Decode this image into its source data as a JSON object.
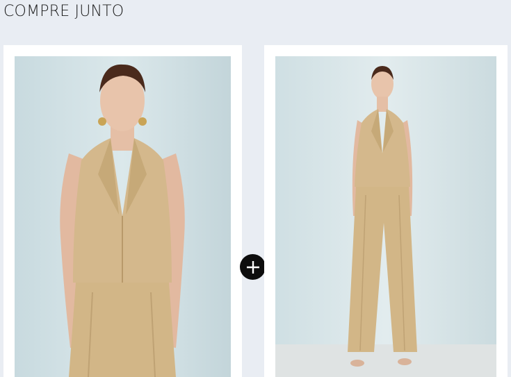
{
  "section": {
    "title": "COMPRE JUNTO"
  },
  "products": [
    {
      "image_icon": "product-photo-vest-top"
    },
    {
      "image_icon": "product-photo-full-outfit"
    }
  ],
  "combine": {
    "icon": "plus-icon"
  },
  "colors": {
    "background": "#e9edf3",
    "card": "#ffffff",
    "photo_backdrop": "#d3e2e6",
    "garment": "#d4b88c",
    "plus_button": "#0d0d0d"
  }
}
